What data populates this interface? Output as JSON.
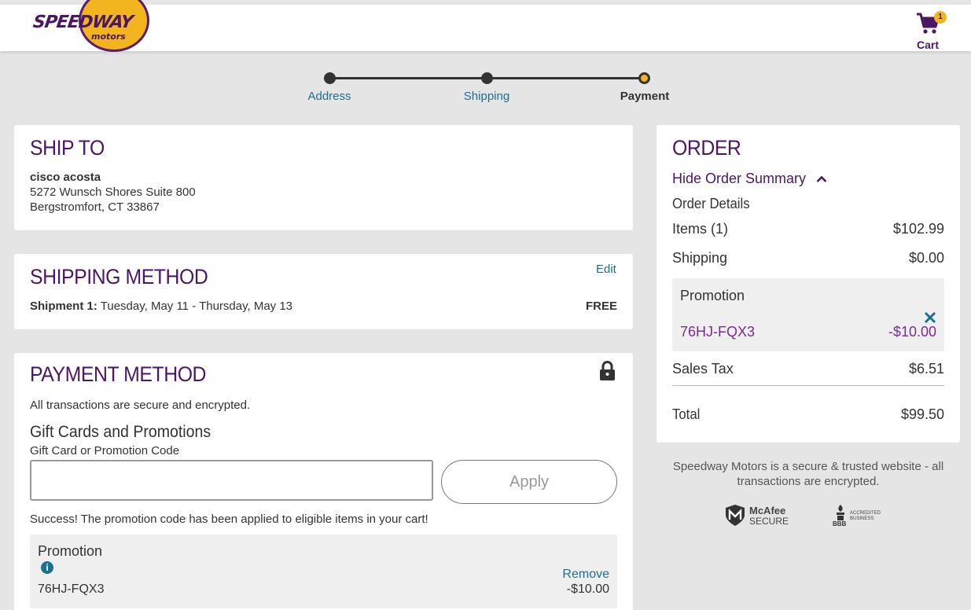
{
  "header": {
    "logo_text": "SPEEDWAY",
    "logo_sub": "motors",
    "cart_label": "Cart",
    "cart_count": "1"
  },
  "stepper": {
    "steps": [
      {
        "label": "Address",
        "state": "complete"
      },
      {
        "label": "Shipping",
        "state": "complete"
      },
      {
        "label": "Payment",
        "state": "current"
      }
    ]
  },
  "ship_to": {
    "title": "SHIP TO",
    "name": "cisco acosta",
    "address_line1": "5272 Wunsch Shores Suite 800",
    "address_line2": "Bergstromfort, CT 33867"
  },
  "shipping_method": {
    "title": "SHIPPING METHOD",
    "edit_label": "Edit",
    "shipment_label": "Shipment 1:",
    "shipment_dates": "Tuesday, May 11 - Thursday, May 13",
    "cost": "FREE"
  },
  "payment_method": {
    "title": "PAYMENT METHOD",
    "secure_text": "All transactions are secure and encrypted.",
    "gift_title": "Gift Cards and Promotions",
    "gift_field_label": "Gift Card or Promotion Code",
    "gift_input_value": "",
    "apply_label": "Apply",
    "success_text": "Success! The promotion code has been applied to eligible items in your cart!",
    "promo": {
      "heading": "Promotion",
      "code": "76HJ-FQX3",
      "remove_label": "Remove",
      "amount": "-$10.00"
    }
  },
  "order": {
    "title": "ORDER",
    "toggle_label": "Hide Order Summary",
    "details_heading": "Order Details",
    "items_label": "Items (1)",
    "items_value": "$102.99",
    "shipping_label": "Shipping",
    "shipping_value": "$0.00",
    "promo_heading": "Promotion",
    "promo_code": "76HJ-FQX3",
    "promo_value": "-$10.00",
    "tax_label": "Sales Tax",
    "tax_value": "$6.51",
    "total_label": "Total",
    "total_value": "$99.50"
  },
  "trust": {
    "text": "Speedway Motors is a secure & trusted website - all transactions are encrypted.",
    "mcafee_name": "McAfee",
    "mcafee_sub": "SECURE",
    "bbb_line1": "ACCREDITED",
    "bbb_line2": "BUSINESS",
    "bbb_label": "BBB"
  },
  "colors": {
    "brand_purple": "#4b1763",
    "brand_gold": "#f2b51f",
    "link_teal": "#1b6f8f",
    "promo_purple": "#7b2d8e"
  }
}
